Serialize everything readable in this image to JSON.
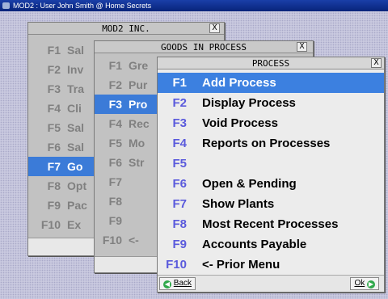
{
  "app": {
    "title": "MOD2 : User John Smith @ Home Secrets"
  },
  "main_menu": {
    "title": "MOD2 INC.",
    "close": "X",
    "items": [
      {
        "key": "F1",
        "label": "Sal"
      },
      {
        "key": "F2",
        "label": "Inv"
      },
      {
        "key": "F3",
        "label": "Tra"
      },
      {
        "key": "F4",
        "label": "Cli"
      },
      {
        "key": "F5",
        "label": "Sal"
      },
      {
        "key": "F6",
        "label": "Sal"
      },
      {
        "key": "F7",
        "label": "Go"
      },
      {
        "key": "F8",
        "label": "Opt"
      },
      {
        "key": "F9",
        "label": "Pac"
      },
      {
        "key": "F10",
        "label": "Ex"
      }
    ]
  },
  "goods_menu": {
    "title": "GOODS IN PROCESS",
    "close": "X",
    "items": [
      {
        "key": "F1",
        "label": "Gre"
      },
      {
        "key": "F2",
        "label": "Pur"
      },
      {
        "key": "F3",
        "label": "Pro"
      },
      {
        "key": "F4",
        "label": "Rec"
      },
      {
        "key": "F5",
        "label": "Mo"
      },
      {
        "key": "F6",
        "label": "Str"
      },
      {
        "key": "F7",
        "label": ""
      },
      {
        "key": "F8",
        "label": ""
      },
      {
        "key": "F9",
        "label": ""
      },
      {
        "key": "F10",
        "label": "<-"
      }
    ]
  },
  "process_menu": {
    "title": "PROCESS",
    "close": "X",
    "items": [
      {
        "key": "F1",
        "label": "Add Process"
      },
      {
        "key": "F2",
        "label": "Display Process"
      },
      {
        "key": "F3",
        "label": "Void Process"
      },
      {
        "key": "F4",
        "label": "Reports on Processes"
      },
      {
        "key": "F5",
        "label": ""
      },
      {
        "key": "F6",
        "label": "Open & Pending"
      },
      {
        "key": "F7",
        "label": "Show Plants"
      },
      {
        "key": "F8",
        "label": "Most Recent Processes"
      },
      {
        "key": "F9",
        "label": "Accounts Payable"
      },
      {
        "key": "F10",
        "label": "<- Prior Menu"
      }
    ],
    "back_button": "Back",
    "ok_button": "Ok"
  },
  "colors": {
    "selection": "#3c80e0",
    "key_blue": "#5a5adc",
    "title_bar": "#0a2a86"
  }
}
